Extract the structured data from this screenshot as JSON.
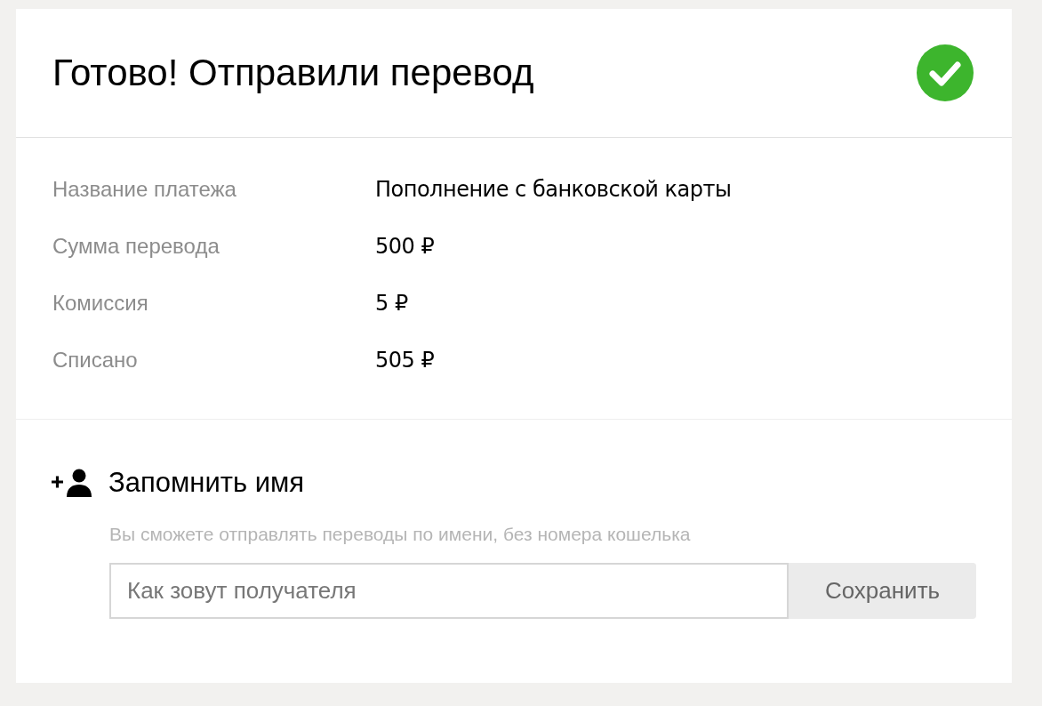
{
  "header": {
    "title": "Готово! Отправили перевод"
  },
  "details": [
    {
      "label": "Название платежа",
      "value": "Пополнение с банковской карты"
    },
    {
      "label": "Сумма перевода",
      "value": "500 ₽"
    },
    {
      "label": "Комиссия",
      "value": "5 ₽"
    },
    {
      "label": "Списано",
      "value": "505 ₽"
    }
  ],
  "remember": {
    "title": "Запомнить имя",
    "hint": "Вы сможете отправлять переводы по имени, без номера кошелька",
    "name_field": {
      "placeholder": "Как зовут получателя"
    },
    "save_button": "Сохранить"
  }
}
